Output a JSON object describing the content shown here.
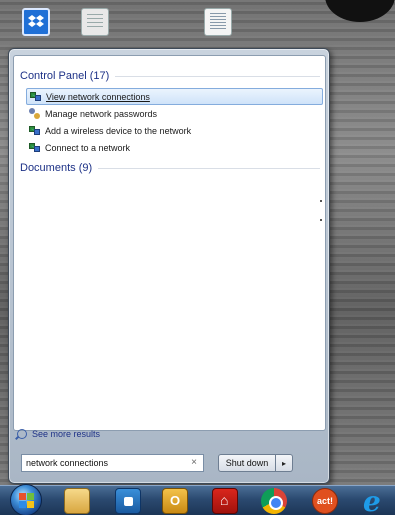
{
  "start_menu": {
    "groups": [
      {
        "header": "Control Panel (17)",
        "items": [
          {
            "label": "View network connections",
            "icon": "network-icon",
            "selected": true
          },
          {
            "label": "Manage network passwords",
            "icon": "credentials-icon",
            "selected": false
          },
          {
            "label": "Add a wireless device to the network",
            "icon": "network-icon",
            "selected": false
          },
          {
            "label": "Connect to a network",
            "icon": "network-icon",
            "selected": false
          }
        ]
      },
      {
        "header": "Documents (9)",
        "items": []
      }
    ],
    "see_more": "See more results",
    "search": {
      "value": "network connections",
      "clear": "×"
    },
    "shutdown": {
      "label": "Shut down",
      "arrow": "▸"
    }
  },
  "desktop_icons": [
    "dropbox-icon",
    "document-icon",
    "document-icon"
  ],
  "taskbar": {
    "act_label": "act!",
    "ie_label": "e",
    "apps": [
      "start-orb",
      "windows-explorer-icon",
      "outlook-icon",
      "outlook-icon",
      "acrobat-icon",
      "chrome-icon",
      "act-icon",
      "internet-explorer-icon"
    ]
  }
}
